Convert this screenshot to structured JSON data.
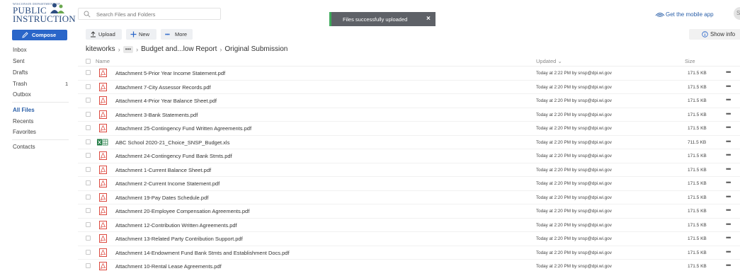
{
  "branding": {
    "logo_small": "WISCONSIN DEPARTMENT OF",
    "logo_line1": "PUBLIC",
    "logo_line2": "INSTRUCTION"
  },
  "search": {
    "placeholder": "Search Files and Folders"
  },
  "toast": {
    "message": "Files successfully uploaded",
    "close": "×"
  },
  "header": {
    "mobile_app": "Get the mobile app",
    "avatar": "S"
  },
  "sidebar": {
    "compose": "Compose",
    "items": [
      {
        "label": "Inbox",
        "count": ""
      },
      {
        "label": "Sent",
        "count": ""
      },
      {
        "label": "Drafts",
        "count": ""
      },
      {
        "label": "Trash",
        "count": "1"
      },
      {
        "label": "Outbox",
        "count": ""
      },
      {
        "label": "All Files",
        "count": ""
      },
      {
        "label": "Recents",
        "count": ""
      },
      {
        "label": "Favorites",
        "count": ""
      },
      {
        "label": "Contacts",
        "count": ""
      }
    ]
  },
  "toolbar": {
    "upload": "Upload",
    "new": "New",
    "more": "More",
    "show_info": "Show info"
  },
  "breadcrumb": {
    "root": "kiteworks",
    "ellipsis": "•••",
    "middle": "Budget and...low Report",
    "current": "Original Submission"
  },
  "table": {
    "columns": {
      "name": "Name",
      "updated": "Updated",
      "size": "Size"
    },
    "rows": [
      {
        "name": "Attachment 5-Prior Year Income Statement.pdf",
        "updated": "Today at 2:22 PM by snsp@dpi.wi.gov",
        "size": "171.5 KB",
        "type": "pdf"
      },
      {
        "name": "Attachment 7-City Assessor Records.pdf",
        "updated": "Today at 2:20 PM by snsp@dpi.wi.gov",
        "size": "171.5 KB",
        "type": "pdf"
      },
      {
        "name": "Attachment 4-Prior Year Balance Sheet.pdf",
        "updated": "Today at 2:20 PM by snsp@dpi.wi.gov",
        "size": "171.5 KB",
        "type": "pdf"
      },
      {
        "name": "Attachment 3-Bank Statements.pdf",
        "updated": "Today at 2:20 PM by snsp@dpi.wi.gov",
        "size": "171.5 KB",
        "type": "pdf"
      },
      {
        "name": "Attachment 25-Contingency Fund Written Agreements.pdf",
        "updated": "Today at 2:20 PM by snsp@dpi.wi.gov",
        "size": "171.5 KB",
        "type": "pdf"
      },
      {
        "name": "ABC School 2020-21_Choice_SNSP_Budget.xls",
        "updated": "Today at 2:20 PM by snsp@dpi.wi.gov",
        "size": "711.5 KB",
        "type": "xls"
      },
      {
        "name": "Attachment 24-Contingency Fund Bank Stmts.pdf",
        "updated": "Today at 2:20 PM by snsp@dpi.wi.gov",
        "size": "171.5 KB",
        "type": "pdf"
      },
      {
        "name": "Attachment 1-Current Balance Sheet.pdf",
        "updated": "Today at 2:20 PM by snsp@dpi.wi.gov",
        "size": "171.5 KB",
        "type": "pdf"
      },
      {
        "name": "Attachment 2-Current Income Statement.pdf",
        "updated": "Today at 2:20 PM by snsp@dpi.wi.gov",
        "size": "171.5 KB",
        "type": "pdf"
      },
      {
        "name": "Attachment 19-Pay Dates Schedule.pdf",
        "updated": "Today at 2:20 PM by snsp@dpi.wi.gov",
        "size": "171.5 KB",
        "type": "pdf"
      },
      {
        "name": "Attachment 20-Employee Compensation Agreements.pdf",
        "updated": "Today at 2:20 PM by snsp@dpi.wi.gov",
        "size": "171.5 KB",
        "type": "pdf"
      },
      {
        "name": "Attachment 12-Contribution Written Agreements.pdf",
        "updated": "Today at 2:20 PM by snsp@dpi.wi.gov",
        "size": "171.5 KB",
        "type": "pdf"
      },
      {
        "name": "Attachment 13-Related Party Contribution Support.pdf",
        "updated": "Today at 2:20 PM by snsp@dpi.wi.gov",
        "size": "171.5 KB",
        "type": "pdf"
      },
      {
        "name": "Attachment 14-Endowment Fund Bank Stmts and Establishment Docs.pdf",
        "updated": "Today at 2:20 PM by snsp@dpi.wi.gov",
        "size": "171.5 KB",
        "type": "pdf"
      },
      {
        "name": "Attachment 10-Rental Lease Agreements.pdf",
        "updated": "Today at 2:20 PM by snsp@dpi.wi.gov",
        "size": "171.5 KB",
        "type": "pdf"
      }
    ]
  },
  "icons": {
    "pdf": "pdf-file-icon",
    "xls": "excel-file-icon",
    "more": "more-actions-icon"
  },
  "colors": {
    "accent": "#2a66c9",
    "toast_bg": "#5e6167",
    "toast_bar": "#3daa5a",
    "pdf_red": "#d9352b",
    "excel_green": "#1f7b43"
  }
}
